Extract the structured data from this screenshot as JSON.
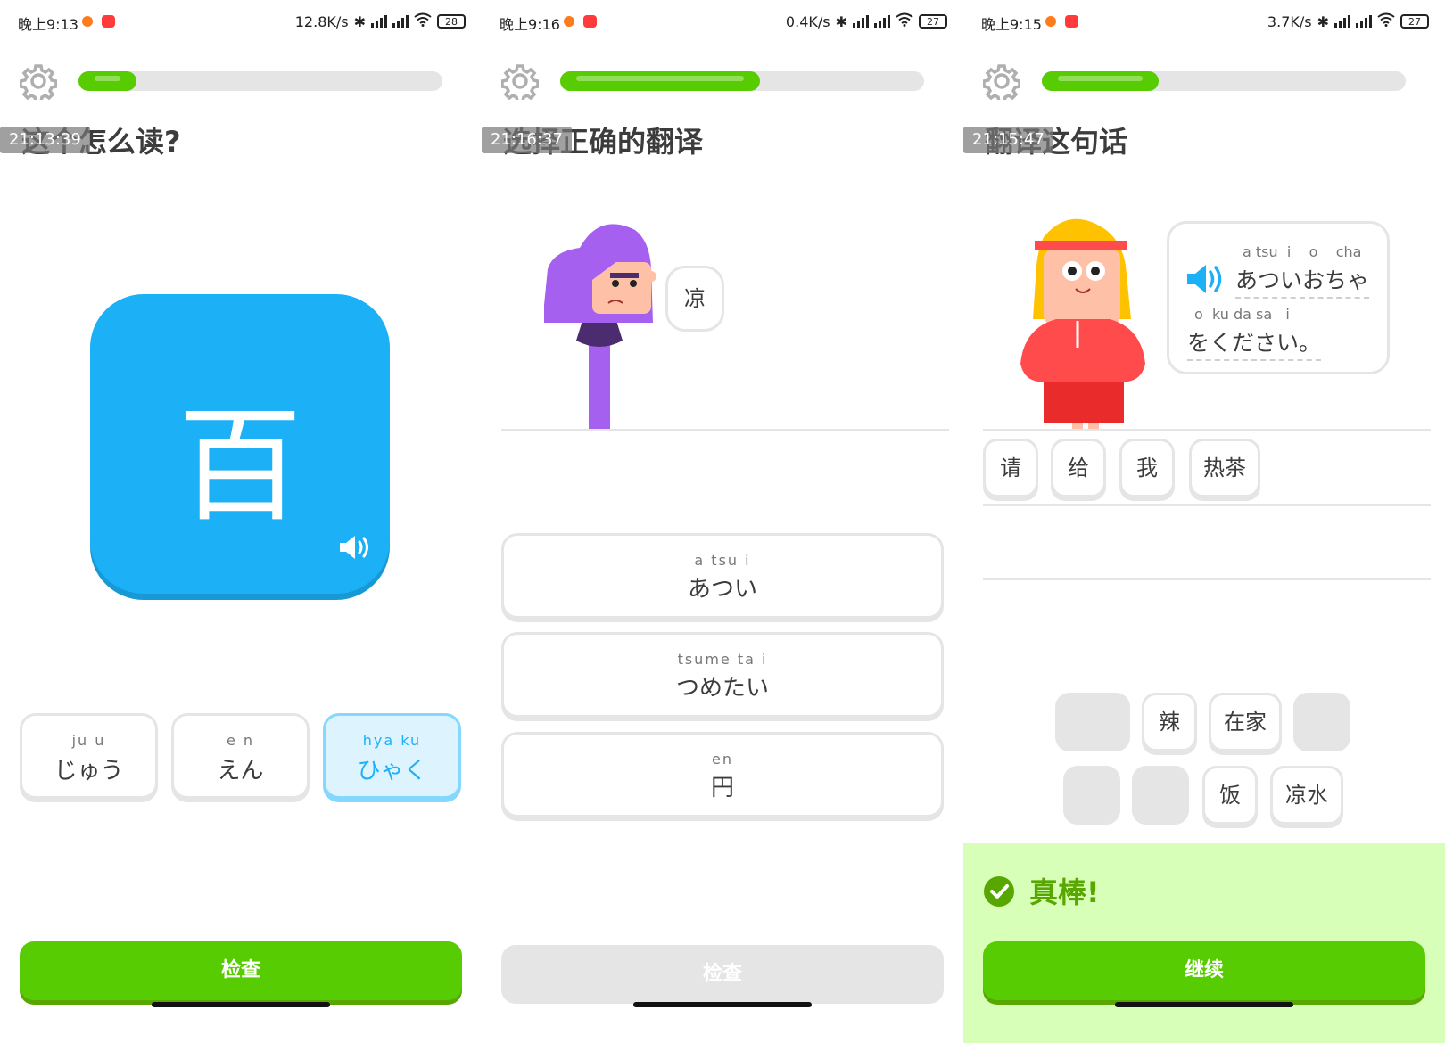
{
  "screens": [
    {
      "status": {
        "time": "晚上9:13",
        "speed": "12.8K/s",
        "battery": "28"
      },
      "progress_fraction": 0.16,
      "timestamp": "21:13:39",
      "title": "这个怎么读?",
      "kanji": "百",
      "options": [
        {
          "furigana": "ju   u",
          "kana": "じゅう",
          "selected": false
        },
        {
          "furigana": "e   n",
          "kana": "えん",
          "selected": false
        },
        {
          "furigana": "hya  ku",
          "kana": "ひゃく",
          "selected": true
        }
      ],
      "button_label": "检查"
    },
    {
      "status": {
        "time": "晚上9:16",
        "speed": "0.4K/s",
        "battery": "27"
      },
      "progress_fraction": 0.55,
      "timestamp": "21:16:37",
      "title": "选择正确的翻译",
      "bubble_text": "凉",
      "choices": [
        {
          "furigana": "a tsu  i",
          "kana": "あつい"
        },
        {
          "furigana": "tsume ta   i",
          "kana": "つめたい"
        },
        {
          "furigana": "en",
          "kana": "円"
        }
      ],
      "button_label": "检查"
    },
    {
      "status": {
        "time": "晚上9:15",
        "speed": "3.7K/s",
        "battery": "27"
      },
      "progress_fraction": 0.32,
      "timestamp": "21:15:47",
      "title": "翻译这句话",
      "bubble_line1_furigana": "a tsu  i    o    cha",
      "bubble_line1": "あついおちゃ",
      "bubble_line2_furigana": "o  ku da sa   i",
      "bubble_line2": "をください。",
      "answer_words": [
        "请",
        "给",
        "我",
        "热茶"
      ],
      "bank_row1": [
        "",
        "辣",
        "在家",
        ""
      ],
      "bank_row2": [
        "",
        "",
        "饭",
        "凉水"
      ],
      "feedback_text": "真棒!",
      "button_label": "继续"
    }
  ],
  "colors": {
    "green": "#58cc02",
    "blue": "#1cb0f6",
    "grey": "#e5e5e5",
    "feedback_bg": "#d7ffb8"
  }
}
